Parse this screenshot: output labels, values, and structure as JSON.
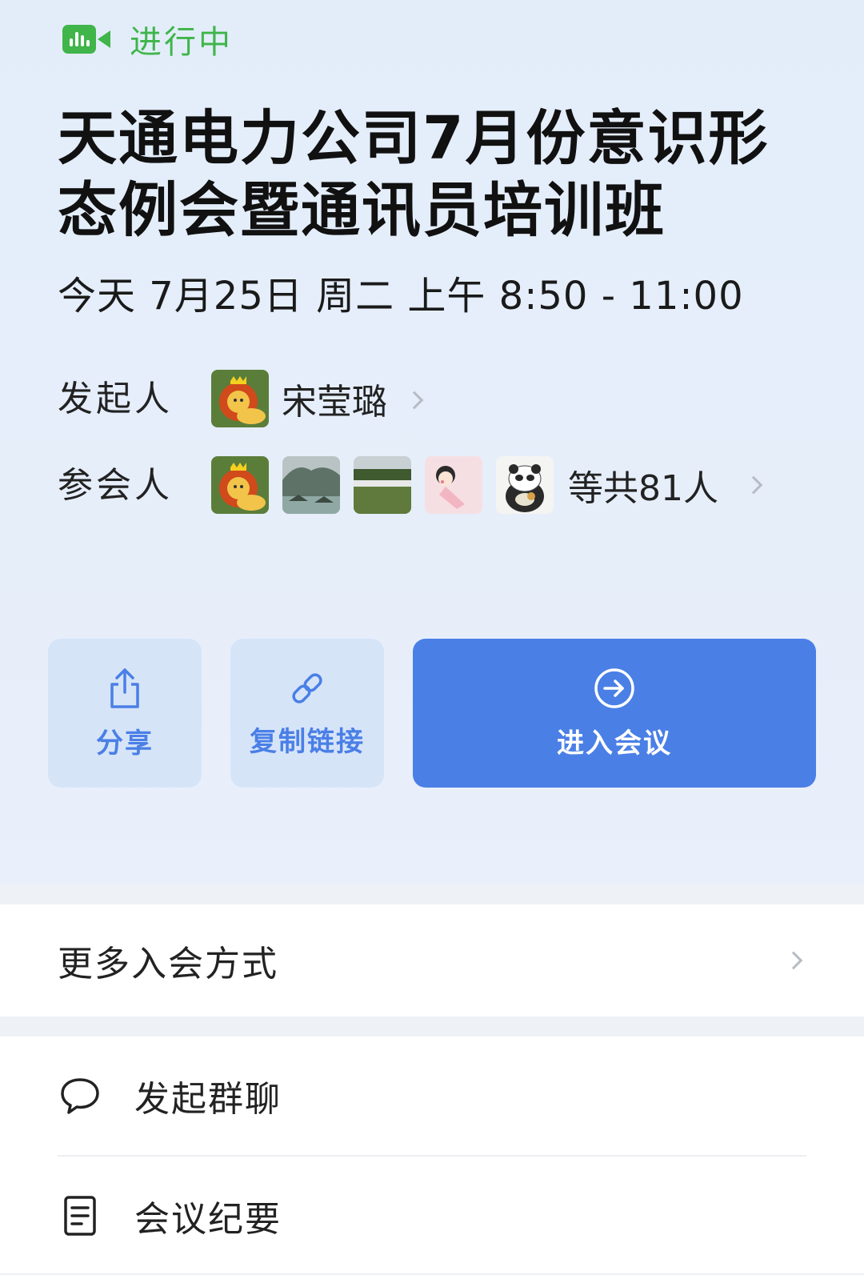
{
  "status": {
    "text": "进行中",
    "icon": "video-camera-icon",
    "color": "#3fb54a"
  },
  "meeting": {
    "title": "天通电力公司7月份意识形态例会暨通讯员培训班",
    "datetime": "今天 7月25日 周二 上午 8:50 - 11:00"
  },
  "organizer": {
    "label": "发起人",
    "name": "宋莹璐"
  },
  "participants": {
    "label": "参会人",
    "summary": "等共81人"
  },
  "actions": {
    "share_label": "分享",
    "copy_link_label": "复制链接",
    "join_label": "进入会议"
  },
  "menu": {
    "more_ways_label": "更多入会方式",
    "group_chat_label": "发起群聊",
    "minutes_label": "会议纪要"
  },
  "colors": {
    "accent": "#4a7fe6",
    "accent_light": "#d6e4f8",
    "status_green": "#3fb54a"
  }
}
